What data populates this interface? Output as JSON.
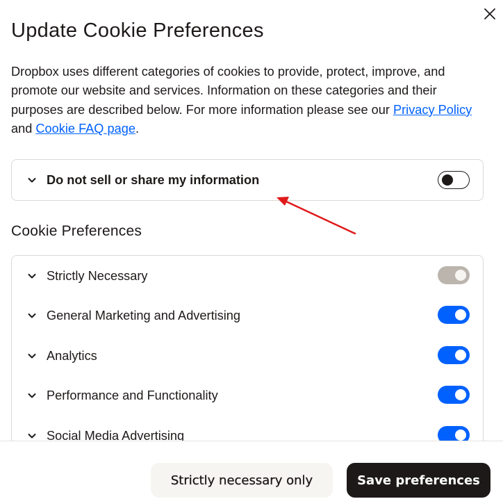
{
  "dialog": {
    "title": "Update Cookie Preferences",
    "close_icon": "close-icon",
    "intro_text": "Dropbox uses different categories of cookies to provide, protect, improve, and promote our website and services. Information on these categories and their purposes are described below. For more information please see our ",
    "privacy_link": "Privacy Policy",
    "and_text": " and ",
    "faq_link": "Cookie FAQ page",
    "period": "."
  },
  "do_not_sell": {
    "label": "Do not sell or share my information",
    "enabled": false
  },
  "cookie_preferences": {
    "title": "Cookie Preferences",
    "items": [
      {
        "label": "Strictly Necessary",
        "state": "on-disabled"
      },
      {
        "label": "General Marketing and Advertising",
        "state": "on"
      },
      {
        "label": "Analytics",
        "state": "on"
      },
      {
        "label": "Performance and Functionality",
        "state": "on"
      },
      {
        "label": "Social Media Advertising",
        "state": "on"
      }
    ]
  },
  "footer": {
    "secondary_label": "Strictly necessary only",
    "primary_label": "Save preferences"
  },
  "colors": {
    "accent": "#0061fe",
    "text": "#1e1919",
    "disabled_toggle": "#bbb5ae",
    "annotation_arrow": "#e0191b"
  }
}
